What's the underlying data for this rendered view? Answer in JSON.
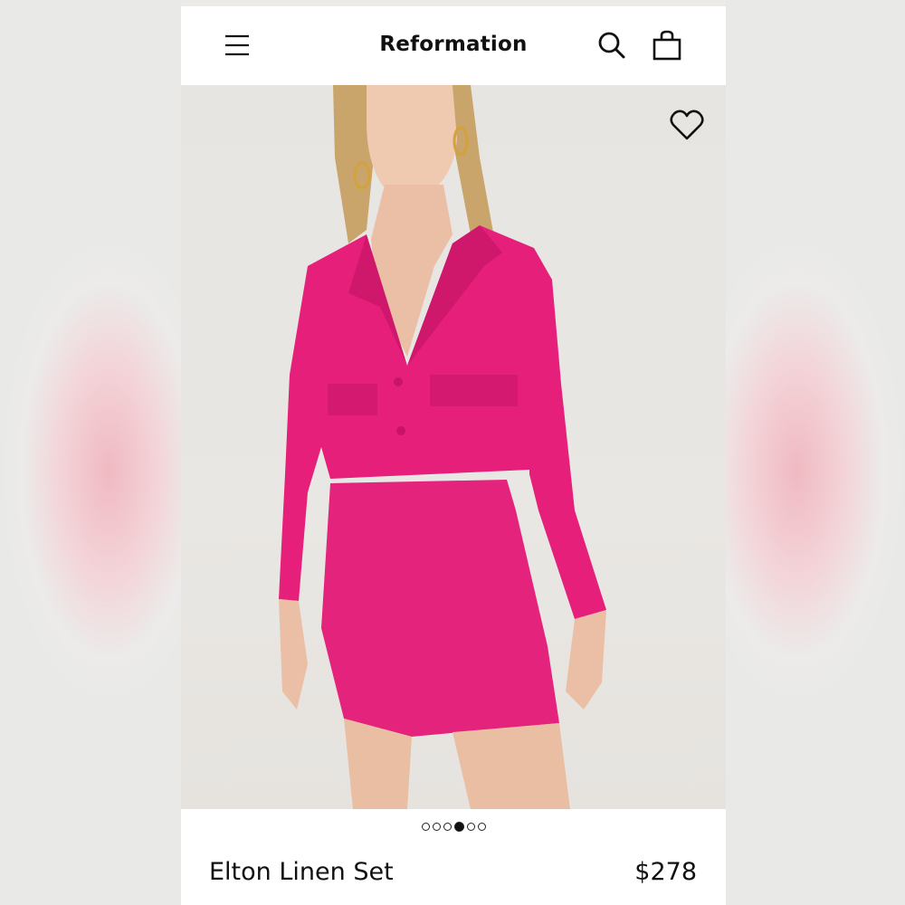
{
  "header": {
    "brand": "Reformation",
    "menu_icon": "hamburger-menu-icon",
    "search_icon": "search-icon",
    "bag_icon": "shopping-bag-icon"
  },
  "product": {
    "name": "Elton Linen Set",
    "price": "$278",
    "favorite_icon": "heart-icon",
    "image_alt": "Model wearing pink cropped linen blazer and mini skirt",
    "garment_color": "#e8207a"
  },
  "gallery": {
    "total_images": 6,
    "active_index": 3
  },
  "colors": {
    "background": "#ffffff",
    "text": "#111111",
    "photo_background": "#e7e5e1"
  }
}
